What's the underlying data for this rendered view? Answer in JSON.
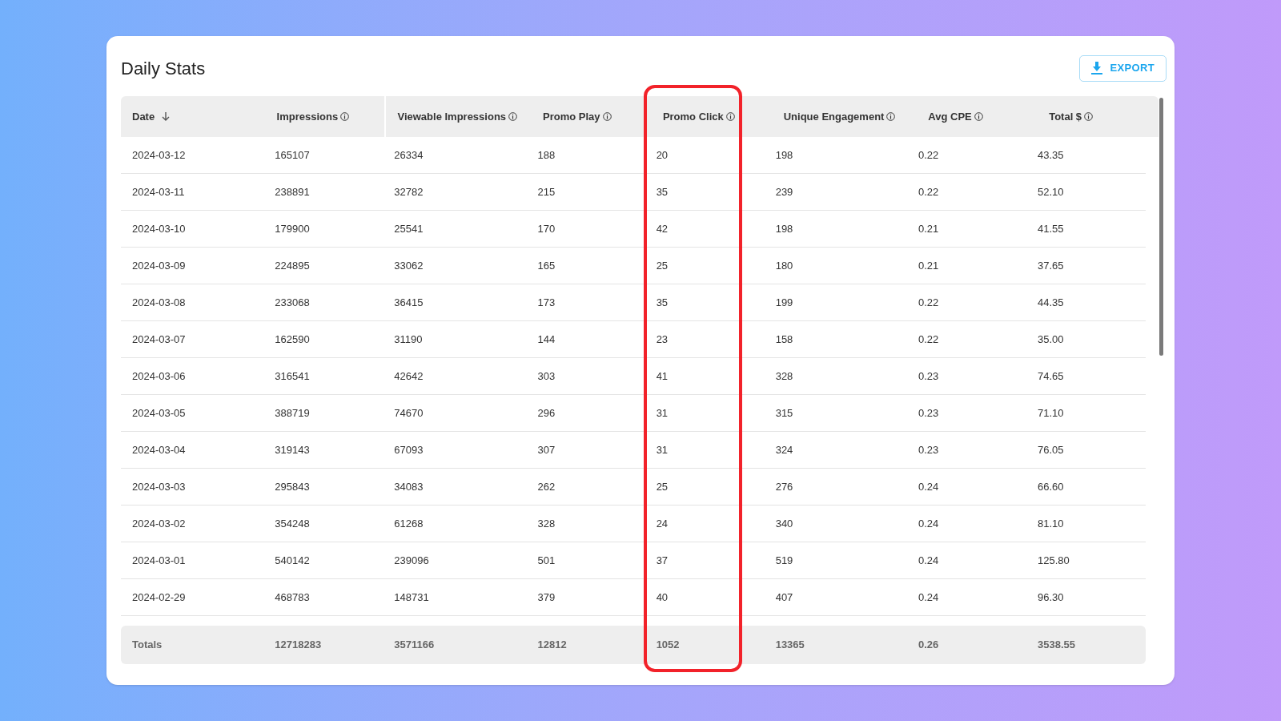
{
  "title": "Daily Stats",
  "export_button": {
    "label": "EXPORT"
  },
  "table": {
    "columns": [
      {
        "label": "Date",
        "info": false,
        "sorted": true,
        "highlighted": false
      },
      {
        "label": "Impressions",
        "info": true,
        "sorted": false,
        "highlighted": false
      },
      {
        "label": "Viewable Impressions",
        "info": true,
        "sorted": false,
        "highlighted": false
      },
      {
        "label": "Promo Play",
        "info": true,
        "sorted": false,
        "highlighted": false
      },
      {
        "label": "Promo Click",
        "info": true,
        "sorted": false,
        "highlighted": true
      },
      {
        "label": "Unique Engagement",
        "info": true,
        "sorted": false,
        "highlighted": false
      },
      {
        "label": "Avg CPE",
        "info": true,
        "sorted": false,
        "highlighted": false
      },
      {
        "label": "Total $",
        "info": true,
        "sorted": false,
        "highlighted": false
      }
    ],
    "rows": [
      [
        "2024-03-12",
        "165107",
        "26334",
        "188",
        "20",
        "198",
        "0.22",
        "43.35"
      ],
      [
        "2024-03-11",
        "238891",
        "32782",
        "215",
        "35",
        "239",
        "0.22",
        "52.10"
      ],
      [
        "2024-03-10",
        "179900",
        "25541",
        "170",
        "42",
        "198",
        "0.21",
        "41.55"
      ],
      [
        "2024-03-09",
        "224895",
        "33062",
        "165",
        "25",
        "180",
        "0.21",
        "37.65"
      ],
      [
        "2024-03-08",
        "233068",
        "36415",
        "173",
        "35",
        "199",
        "0.22",
        "44.35"
      ],
      [
        "2024-03-07",
        "162590",
        "31190",
        "144",
        "23",
        "158",
        "0.22",
        "35.00"
      ],
      [
        "2024-03-06",
        "316541",
        "42642",
        "303",
        "41",
        "328",
        "0.23",
        "74.65"
      ],
      [
        "2024-03-05",
        "388719",
        "74670",
        "296",
        "31",
        "315",
        "0.23",
        "71.10"
      ],
      [
        "2024-03-04",
        "319143",
        "67093",
        "307",
        "31",
        "324",
        "0.23",
        "76.05"
      ],
      [
        "2024-03-03",
        "295843",
        "34083",
        "262",
        "25",
        "276",
        "0.24",
        "66.60"
      ],
      [
        "2024-03-02",
        "354248",
        "61268",
        "328",
        "24",
        "340",
        "0.24",
        "81.10"
      ],
      [
        "2024-03-01",
        "540142",
        "239096",
        "501",
        "37",
        "519",
        "0.24",
        "125.80"
      ],
      [
        "2024-02-29",
        "468783",
        "148731",
        "379",
        "40",
        "407",
        "0.24",
        "96.30"
      ]
    ],
    "totals": [
      "Totals",
      "12718283",
      "3571166",
      "12812",
      "1052",
      "13365",
      "0.26",
      "3538.55"
    ]
  }
}
